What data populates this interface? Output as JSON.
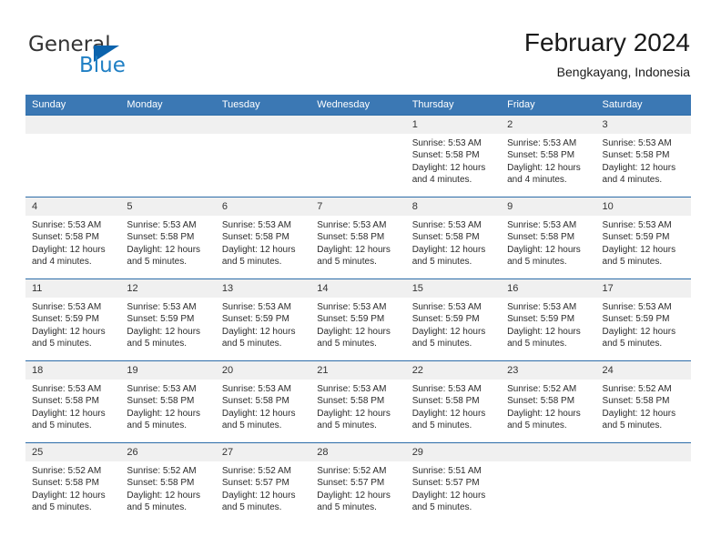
{
  "brand": {
    "name_top": "General",
    "name_bottom": "Blue",
    "accent_color": "#1f7fc4",
    "triangle_color": "#0b63ad"
  },
  "header": {
    "title": "February 2024",
    "subtitle": "Bengkayang, Indonesia"
  },
  "theme": {
    "header_bg": "#3b78b4",
    "header_text": "#ffffff",
    "daynum_bg": "#f0f0f0",
    "row_border": "#2c6ca8"
  },
  "weekdays": [
    "Sunday",
    "Monday",
    "Tuesday",
    "Wednesday",
    "Thursday",
    "Friday",
    "Saturday"
  ],
  "weeks": [
    [
      {
        "day": "",
        "sunrise": "",
        "sunset": "",
        "daylight": "",
        "empty": true
      },
      {
        "day": "",
        "sunrise": "",
        "sunset": "",
        "daylight": "",
        "empty": true
      },
      {
        "day": "",
        "sunrise": "",
        "sunset": "",
        "daylight": "",
        "empty": true
      },
      {
        "day": "",
        "sunrise": "",
        "sunset": "",
        "daylight": "",
        "empty": true
      },
      {
        "day": "1",
        "sunrise": "Sunrise: 5:53 AM",
        "sunset": "Sunset: 5:58 PM",
        "daylight": "Daylight: 12 hours and 4 minutes."
      },
      {
        "day": "2",
        "sunrise": "Sunrise: 5:53 AM",
        "sunset": "Sunset: 5:58 PM",
        "daylight": "Daylight: 12 hours and 4 minutes."
      },
      {
        "day": "3",
        "sunrise": "Sunrise: 5:53 AM",
        "sunset": "Sunset: 5:58 PM",
        "daylight": "Daylight: 12 hours and 4 minutes."
      }
    ],
    [
      {
        "day": "4",
        "sunrise": "Sunrise: 5:53 AM",
        "sunset": "Sunset: 5:58 PM",
        "daylight": "Daylight: 12 hours and 4 minutes."
      },
      {
        "day": "5",
        "sunrise": "Sunrise: 5:53 AM",
        "sunset": "Sunset: 5:58 PM",
        "daylight": "Daylight: 12 hours and 5 minutes."
      },
      {
        "day": "6",
        "sunrise": "Sunrise: 5:53 AM",
        "sunset": "Sunset: 5:58 PM",
        "daylight": "Daylight: 12 hours and 5 minutes."
      },
      {
        "day": "7",
        "sunrise": "Sunrise: 5:53 AM",
        "sunset": "Sunset: 5:58 PM",
        "daylight": "Daylight: 12 hours and 5 minutes."
      },
      {
        "day": "8",
        "sunrise": "Sunrise: 5:53 AM",
        "sunset": "Sunset: 5:58 PM",
        "daylight": "Daylight: 12 hours and 5 minutes."
      },
      {
        "day": "9",
        "sunrise": "Sunrise: 5:53 AM",
        "sunset": "Sunset: 5:58 PM",
        "daylight": "Daylight: 12 hours and 5 minutes."
      },
      {
        "day": "10",
        "sunrise": "Sunrise: 5:53 AM",
        "sunset": "Sunset: 5:59 PM",
        "daylight": "Daylight: 12 hours and 5 minutes."
      }
    ],
    [
      {
        "day": "11",
        "sunrise": "Sunrise: 5:53 AM",
        "sunset": "Sunset: 5:59 PM",
        "daylight": "Daylight: 12 hours and 5 minutes."
      },
      {
        "day": "12",
        "sunrise": "Sunrise: 5:53 AM",
        "sunset": "Sunset: 5:59 PM",
        "daylight": "Daylight: 12 hours and 5 minutes."
      },
      {
        "day": "13",
        "sunrise": "Sunrise: 5:53 AM",
        "sunset": "Sunset: 5:59 PM",
        "daylight": "Daylight: 12 hours and 5 minutes."
      },
      {
        "day": "14",
        "sunrise": "Sunrise: 5:53 AM",
        "sunset": "Sunset: 5:59 PM",
        "daylight": "Daylight: 12 hours and 5 minutes."
      },
      {
        "day": "15",
        "sunrise": "Sunrise: 5:53 AM",
        "sunset": "Sunset: 5:59 PM",
        "daylight": "Daylight: 12 hours and 5 minutes."
      },
      {
        "day": "16",
        "sunrise": "Sunrise: 5:53 AM",
        "sunset": "Sunset: 5:59 PM",
        "daylight": "Daylight: 12 hours and 5 minutes."
      },
      {
        "day": "17",
        "sunrise": "Sunrise: 5:53 AM",
        "sunset": "Sunset: 5:59 PM",
        "daylight": "Daylight: 12 hours and 5 minutes."
      }
    ],
    [
      {
        "day": "18",
        "sunrise": "Sunrise: 5:53 AM",
        "sunset": "Sunset: 5:58 PM",
        "daylight": "Daylight: 12 hours and 5 minutes."
      },
      {
        "day": "19",
        "sunrise": "Sunrise: 5:53 AM",
        "sunset": "Sunset: 5:58 PM",
        "daylight": "Daylight: 12 hours and 5 minutes."
      },
      {
        "day": "20",
        "sunrise": "Sunrise: 5:53 AM",
        "sunset": "Sunset: 5:58 PM",
        "daylight": "Daylight: 12 hours and 5 minutes."
      },
      {
        "day": "21",
        "sunrise": "Sunrise: 5:53 AM",
        "sunset": "Sunset: 5:58 PM",
        "daylight": "Daylight: 12 hours and 5 minutes."
      },
      {
        "day": "22",
        "sunrise": "Sunrise: 5:53 AM",
        "sunset": "Sunset: 5:58 PM",
        "daylight": "Daylight: 12 hours and 5 minutes."
      },
      {
        "day": "23",
        "sunrise": "Sunrise: 5:52 AM",
        "sunset": "Sunset: 5:58 PM",
        "daylight": "Daylight: 12 hours and 5 minutes."
      },
      {
        "day": "24",
        "sunrise": "Sunrise: 5:52 AM",
        "sunset": "Sunset: 5:58 PM",
        "daylight": "Daylight: 12 hours and 5 minutes."
      }
    ],
    [
      {
        "day": "25",
        "sunrise": "Sunrise: 5:52 AM",
        "sunset": "Sunset: 5:58 PM",
        "daylight": "Daylight: 12 hours and 5 minutes."
      },
      {
        "day": "26",
        "sunrise": "Sunrise: 5:52 AM",
        "sunset": "Sunset: 5:58 PM",
        "daylight": "Daylight: 12 hours and 5 minutes."
      },
      {
        "day": "27",
        "sunrise": "Sunrise: 5:52 AM",
        "sunset": "Sunset: 5:57 PM",
        "daylight": "Daylight: 12 hours and 5 minutes."
      },
      {
        "day": "28",
        "sunrise": "Sunrise: 5:52 AM",
        "sunset": "Sunset: 5:57 PM",
        "daylight": "Daylight: 12 hours and 5 minutes."
      },
      {
        "day": "29",
        "sunrise": "Sunrise: 5:51 AM",
        "sunset": "Sunset: 5:57 PM",
        "daylight": "Daylight: 12 hours and 5 minutes."
      },
      {
        "day": "",
        "sunrise": "",
        "sunset": "",
        "daylight": "",
        "empty": true
      },
      {
        "day": "",
        "sunrise": "",
        "sunset": "",
        "daylight": "",
        "empty": true
      }
    ]
  ]
}
